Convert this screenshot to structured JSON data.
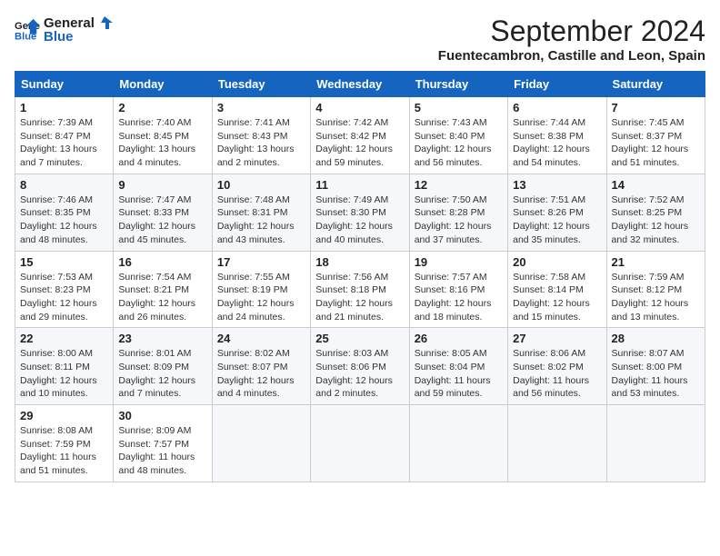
{
  "logo": {
    "general": "General",
    "blue": "Blue"
  },
  "title": "September 2024",
  "subtitle": "Fuentecambron, Castille and Leon, Spain",
  "days_of_week": [
    "Sunday",
    "Monday",
    "Tuesday",
    "Wednesday",
    "Thursday",
    "Friday",
    "Saturday"
  ],
  "weeks": [
    [
      {
        "day": 1,
        "rise": "7:39 AM",
        "set": "8:47 PM",
        "daylight": "13 hours and 7 minutes."
      },
      {
        "day": 2,
        "rise": "7:40 AM",
        "set": "8:45 PM",
        "daylight": "13 hours and 4 minutes."
      },
      {
        "day": 3,
        "rise": "7:41 AM",
        "set": "8:43 PM",
        "daylight": "13 hours and 2 minutes."
      },
      {
        "day": 4,
        "rise": "7:42 AM",
        "set": "8:42 PM",
        "daylight": "12 hours and 59 minutes."
      },
      {
        "day": 5,
        "rise": "7:43 AM",
        "set": "8:40 PM",
        "daylight": "12 hours and 56 minutes."
      },
      {
        "day": 6,
        "rise": "7:44 AM",
        "set": "8:38 PM",
        "daylight": "12 hours and 54 minutes."
      },
      {
        "day": 7,
        "rise": "7:45 AM",
        "set": "8:37 PM",
        "daylight": "12 hours and 51 minutes."
      }
    ],
    [
      {
        "day": 8,
        "rise": "7:46 AM",
        "set": "8:35 PM",
        "daylight": "12 hours and 48 minutes."
      },
      {
        "day": 9,
        "rise": "7:47 AM",
        "set": "8:33 PM",
        "daylight": "12 hours and 45 minutes."
      },
      {
        "day": 10,
        "rise": "7:48 AM",
        "set": "8:31 PM",
        "daylight": "12 hours and 43 minutes."
      },
      {
        "day": 11,
        "rise": "7:49 AM",
        "set": "8:30 PM",
        "daylight": "12 hours and 40 minutes."
      },
      {
        "day": 12,
        "rise": "7:50 AM",
        "set": "8:28 PM",
        "daylight": "12 hours and 37 minutes."
      },
      {
        "day": 13,
        "rise": "7:51 AM",
        "set": "8:26 PM",
        "daylight": "12 hours and 35 minutes."
      },
      {
        "day": 14,
        "rise": "7:52 AM",
        "set": "8:25 PM",
        "daylight": "12 hours and 32 minutes."
      }
    ],
    [
      {
        "day": 15,
        "rise": "7:53 AM",
        "set": "8:23 PM",
        "daylight": "12 hours and 29 minutes."
      },
      {
        "day": 16,
        "rise": "7:54 AM",
        "set": "8:21 PM",
        "daylight": "12 hours and 26 minutes."
      },
      {
        "day": 17,
        "rise": "7:55 AM",
        "set": "8:19 PM",
        "daylight": "12 hours and 24 minutes."
      },
      {
        "day": 18,
        "rise": "7:56 AM",
        "set": "8:18 PM",
        "daylight": "12 hours and 21 minutes."
      },
      {
        "day": 19,
        "rise": "7:57 AM",
        "set": "8:16 PM",
        "daylight": "12 hours and 18 minutes."
      },
      {
        "day": 20,
        "rise": "7:58 AM",
        "set": "8:14 PM",
        "daylight": "12 hours and 15 minutes."
      },
      {
        "day": 21,
        "rise": "7:59 AM",
        "set": "8:12 PM",
        "daylight": "12 hours and 13 minutes."
      }
    ],
    [
      {
        "day": 22,
        "rise": "8:00 AM",
        "set": "8:11 PM",
        "daylight": "12 hours and 10 minutes."
      },
      {
        "day": 23,
        "rise": "8:01 AM",
        "set": "8:09 PM",
        "daylight": "12 hours and 7 minutes."
      },
      {
        "day": 24,
        "rise": "8:02 AM",
        "set": "8:07 PM",
        "daylight": "12 hours and 4 minutes."
      },
      {
        "day": 25,
        "rise": "8:03 AM",
        "set": "8:06 PM",
        "daylight": "12 hours and 2 minutes."
      },
      {
        "day": 26,
        "rise": "8:05 AM",
        "set": "8:04 PM",
        "daylight": "11 hours and 59 minutes."
      },
      {
        "day": 27,
        "rise": "8:06 AM",
        "set": "8:02 PM",
        "daylight": "11 hours and 56 minutes."
      },
      {
        "day": 28,
        "rise": "8:07 AM",
        "set": "8:00 PM",
        "daylight": "11 hours and 53 minutes."
      }
    ],
    [
      {
        "day": 29,
        "rise": "8:08 AM",
        "set": "7:59 PM",
        "daylight": "11 hours and 51 minutes."
      },
      {
        "day": 30,
        "rise": "8:09 AM",
        "set": "7:57 PM",
        "daylight": "11 hours and 48 minutes."
      },
      null,
      null,
      null,
      null,
      null
    ]
  ]
}
